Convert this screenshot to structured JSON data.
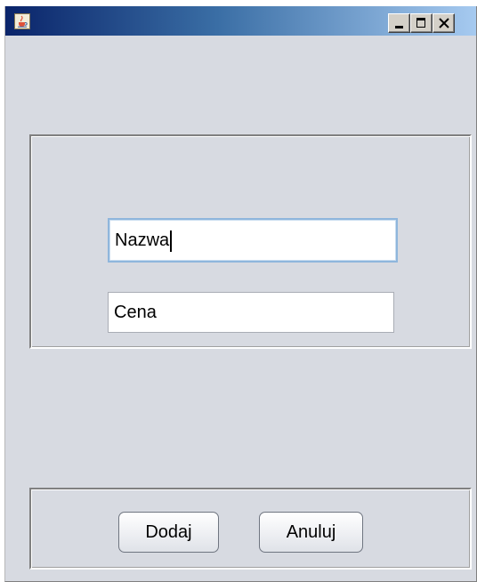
{
  "window": {
    "title": "",
    "icon": "java-cup-icon",
    "controls": {
      "minimize": "minimize-icon",
      "maximize": "maximize-icon",
      "close": "close-icon"
    }
  },
  "form": {
    "name_field": {
      "value": "Nazwa",
      "focused": true
    },
    "price_field": {
      "value": "Cena"
    }
  },
  "actions": {
    "add_label": "Dodaj",
    "cancel_label": "Anuluj"
  },
  "colors": {
    "window_bg": "#d7dae1",
    "titlebar_start": "#0a246a",
    "titlebar_end": "#a6caf0",
    "focus_border": "#8fb6dc"
  }
}
